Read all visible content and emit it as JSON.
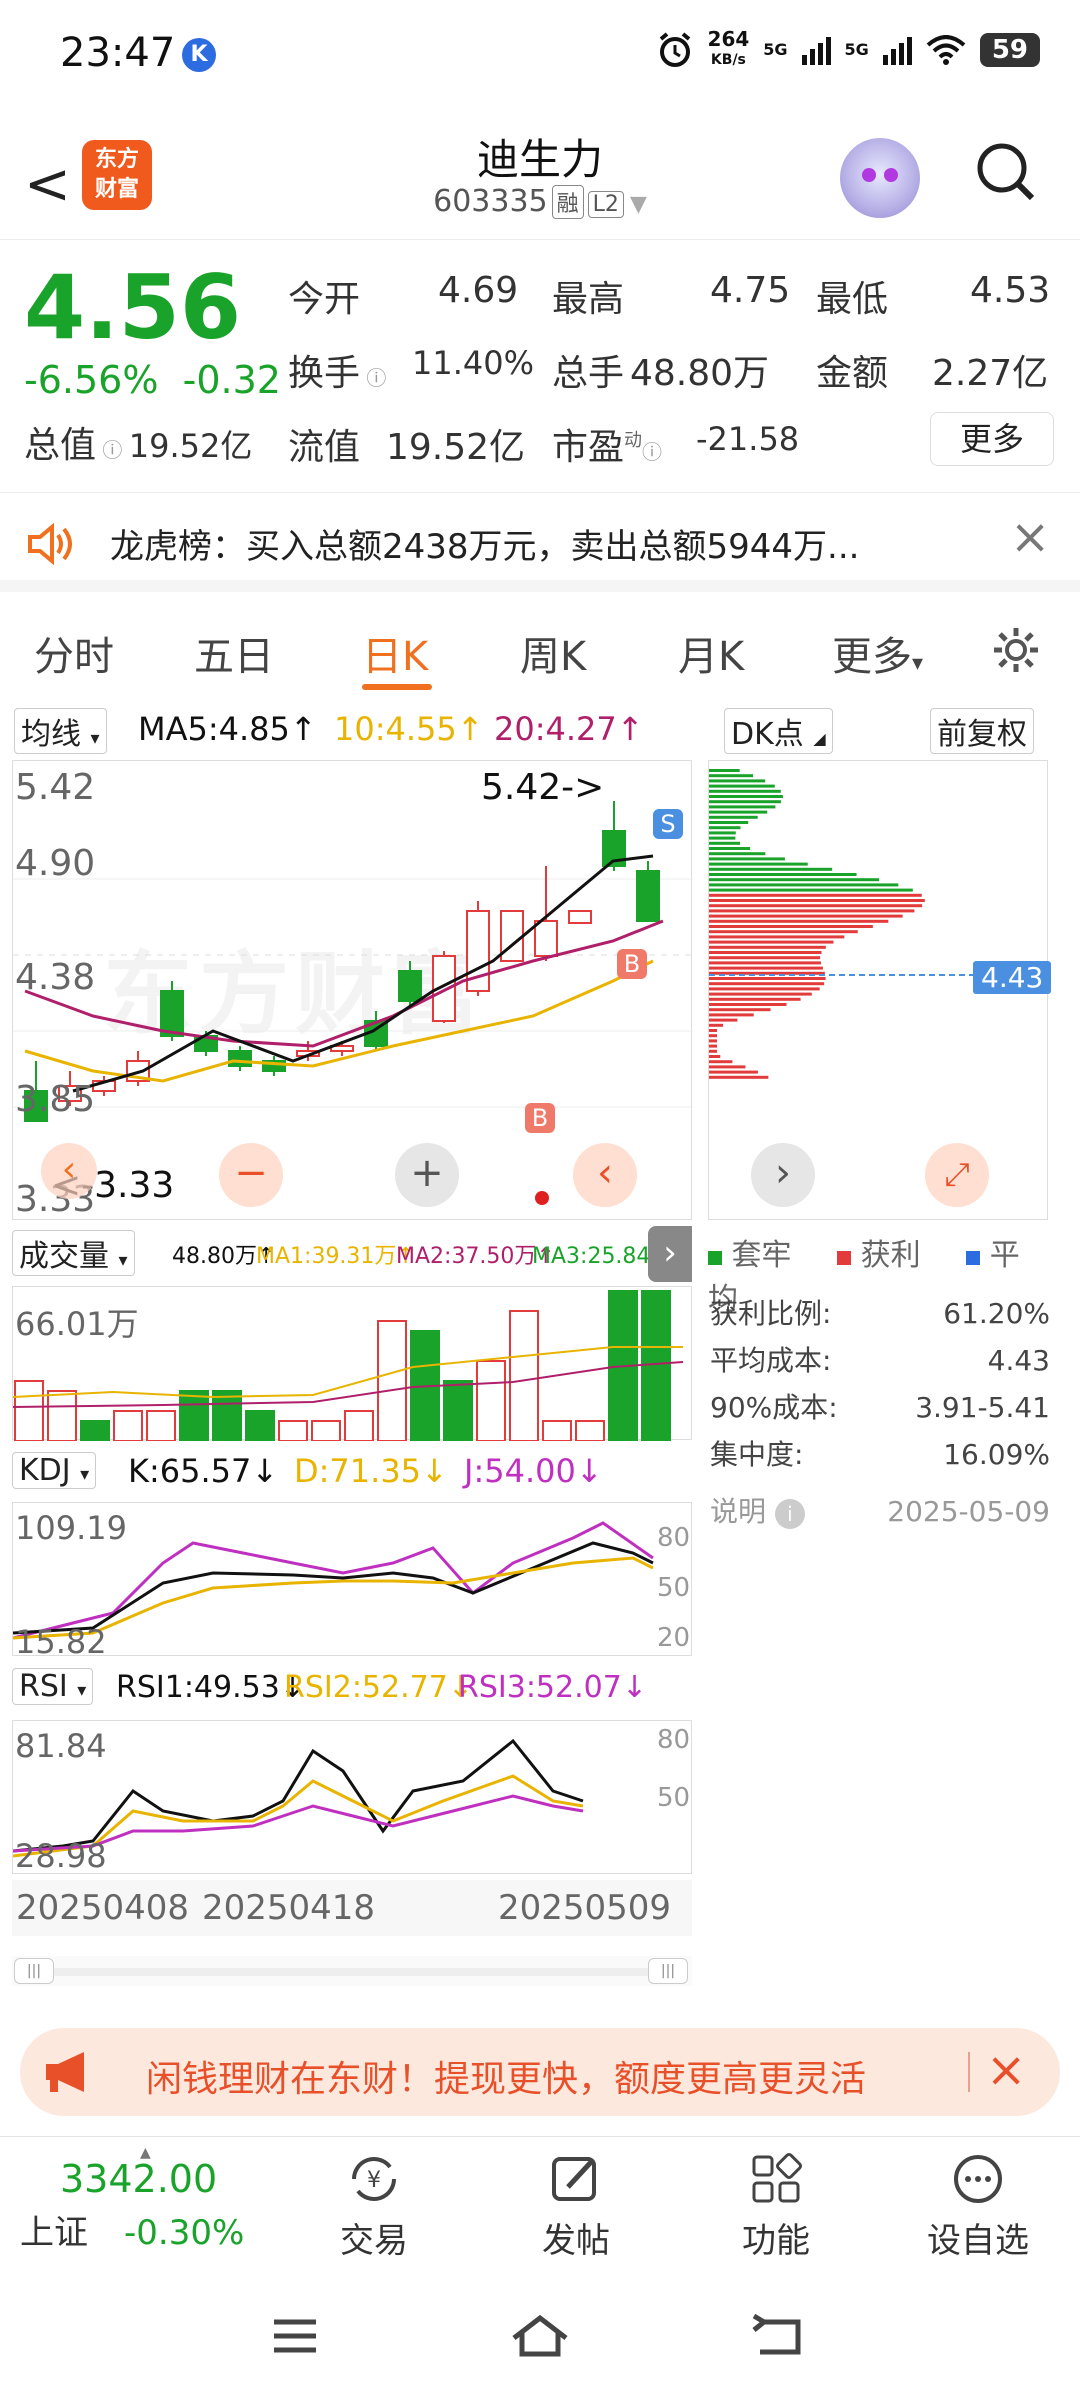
{
  "status": {
    "time": "23:47",
    "k_badge": "K",
    "speed": "264",
    "speed_unit": "KB/s",
    "net1": "5G",
    "net2": "5G",
    "battery": "59"
  },
  "header": {
    "back": "<",
    "logo_line1": "东方",
    "logo_line2": "财富",
    "title": "迪生力",
    "code": "603335",
    "tag_rong": "融",
    "tag_l2": "L2"
  },
  "quote": {
    "price": "4.56",
    "change_pct": "-6.56%",
    "change_amt": "-0.32",
    "open_label": "今开",
    "open": "4.69",
    "high_label": "最高",
    "high": "4.75",
    "low_label": "最低",
    "low": "4.53",
    "turnover_label": "换手",
    "turnover": "11.40%",
    "volume_label": "总手",
    "volume": "48.80万",
    "amount_label": "金额",
    "amount": "2.27亿",
    "mcap_label": "总值",
    "mcap": "19.52亿",
    "float_label": "流值",
    "float": "19.52亿",
    "pe_label": "市盈",
    "pe_sup": "动",
    "pe": "-21.58",
    "more_label": "更多"
  },
  "dragon": {
    "text": "龙虎榜：买入总额2438万元，卖出总额5944万...",
    "close": "×"
  },
  "tabs": {
    "items": [
      "分时",
      "五日",
      "日K",
      "周K",
      "月K",
      "更多"
    ],
    "active": "日K",
    "more_arrow": "▾"
  },
  "kline": {
    "ma_select": "均线",
    "ma5": "MA5:4.85",
    "ma10": "10:4.55",
    "ma20": "20:4.27",
    "up": "↑",
    "dk_select": "DK点",
    "fq_btn": "前复权",
    "y_top": "5.42",
    "y_2": "4.90",
    "y_3": "4.38",
    "y_4": "3.85",
    "y_bottom": "3.33",
    "high_label": "5.42->",
    "low_label": "<-3.33",
    "marker_s": "S",
    "marker_b": "B",
    "watermark": "东方财富"
  },
  "volume": {
    "select": "成交量",
    "vol": "48.80万",
    "ma1": "MA1:39.31万",
    "ma2": "MA2:37.50万",
    "ma3": "MA3:25.84万",
    "y_top": "66.01万"
  },
  "kdj": {
    "select": "KDJ",
    "k": "K:65.57",
    "d": "D:71.35",
    "j": "J:54.00",
    "y_top": "109.19",
    "y_bottom": "15.82",
    "r80": "80",
    "r50": "50",
    "r20": "20"
  },
  "rsi": {
    "select": "RSI",
    "r1": "RSI1:49.53",
    "r2": "RSI2:52.77",
    "r3": "RSI3:52.07",
    "y_top": "81.84",
    "y_bottom": "28.98",
    "r80": "80",
    "r50": "50"
  },
  "dates": {
    "d1": "20250408",
    "d2": "20250418",
    "d3": "20250509"
  },
  "chip": {
    "price_tag": "4.43",
    "legend_trap": "套牢",
    "legend_profit": "获利",
    "legend_avg": "平均",
    "profit_ratio_label": "获利比例:",
    "profit_ratio": "61.20%",
    "avg_cost_label": "平均成本:",
    "avg_cost": "4.43",
    "cost90_label": "90%成本:",
    "cost90": "3.91-5.41",
    "concentration_label": "集中度:",
    "concentration": "16.09%",
    "note_label": "说明",
    "date": "2025-05-09"
  },
  "promo": {
    "text": "闲钱理财在东财！提现更快，额度更高更灵活",
    "close": "×"
  },
  "bottom": {
    "index_value": "3342.00",
    "index_name": "上证",
    "index_change": "-0.30%",
    "trade": "交易",
    "post": "发帖",
    "func": "功能",
    "watch": "设自选"
  },
  "colors": {
    "up": "#e23b3b",
    "down": "#1aa32a",
    "accent": "#f07020",
    "ma5": "#111111",
    "ma10": "#e8b400",
    "ma20": "#b0206a",
    "j_line": "#c030c0"
  }
}
